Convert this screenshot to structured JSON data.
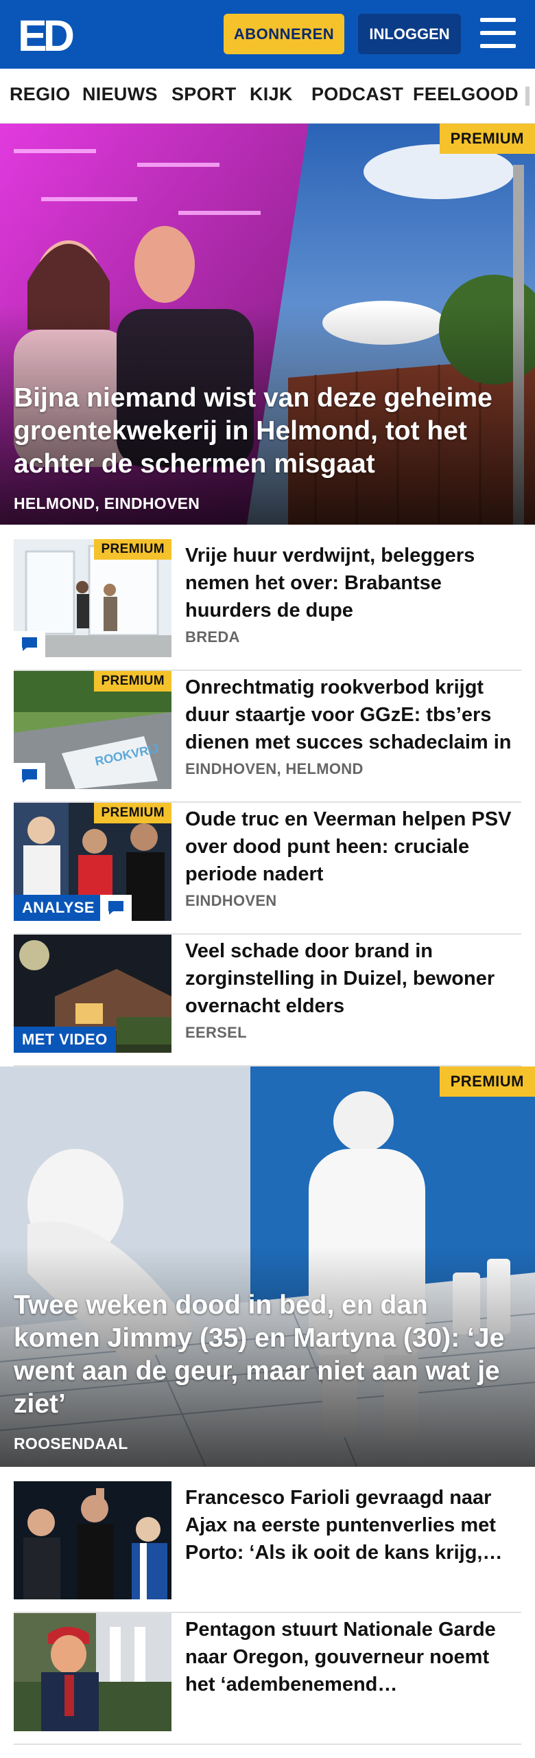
{
  "header": {
    "logo": "ED",
    "subscribe_label": "ABONNEREN",
    "login_label": "INLOGGEN",
    "menu_icon": "hamburger-menu-icon",
    "brand_color": "#0a56b8",
    "accent_color": "#f5c22b"
  },
  "nav": {
    "items": [
      "REGIO",
      "NIEUWS",
      "SPORT",
      "KIJK",
      "PODCAST",
      "FEELGOOD"
    ]
  },
  "hero1": {
    "badge": "PREMIUM",
    "title": "Bijna niemand wist van deze geheime groentekwekerij in Helmond, tot het achter de schermen misgaat",
    "location": "HELMOND, EINDHOVEN"
  },
  "articles": [
    {
      "badge": "PREMIUM",
      "title": "Vrije huur verdwijnt, beleggers nemen het over: Brabantse huurders de dupe",
      "location": "BREDA",
      "comment_icon": "comment-icon"
    },
    {
      "badge": "PREMIUM",
      "title": "Onrechtmatig rookverbod krijgt duur staartje voor GGzE: tbs’ers dienen met succes schadeclaim in",
      "location": "EINDHOVEN, HELMOND",
      "comment_icon": "comment-icon"
    },
    {
      "badge": "PREMIUM",
      "title": "Oude truc en Veerman helpen PSV over dood punt heen: cruciale periode nadert",
      "location": "EINDHOVEN",
      "label": "ANALYSE",
      "comment_icon": "comment-icon"
    },
    {
      "title": "Veel schade door brand in zorginstelling in Duizel, bewoner overnacht elders",
      "location": "EERSEL",
      "label": "MET VIDEO"
    }
  ],
  "hero2": {
    "badge": "PREMIUM",
    "title": "Twee weken dood in bed, en dan komen Jimmy (35) en Martyna (30): ‘Je went aan de geur, maar niet aan wat je ziet’",
    "location": "ROOSENDAAL"
  },
  "articles2": [
    {
      "title": "Francesco Farioli gevraagd naar Ajax na eerste puntenverlies met Porto: ‘Als ik ooit de kans krijg, dan…’"
    },
    {
      "title": "Pentagon stuurt Nationale Garde naar Oregon, gouverneur noemt het ‘adembenemend machtsmisbruik’"
    }
  ]
}
